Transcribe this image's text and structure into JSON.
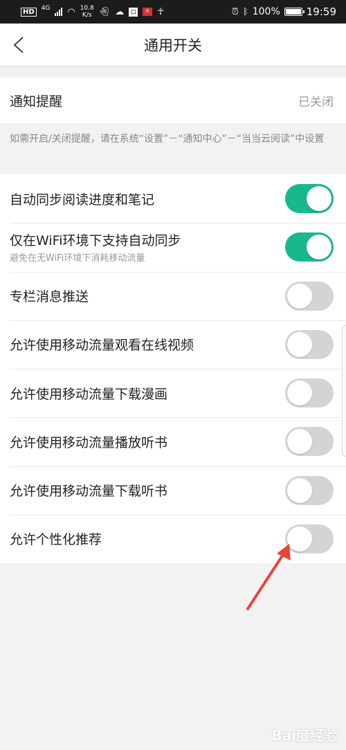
{
  "status_bar": {
    "hd": "HD",
    "network": "4G",
    "speed_top": "10.8",
    "speed_bottom": "K/s",
    "battery": "100%",
    "time": "19:59"
  },
  "header": {
    "title": "通用开关",
    "back_icon": "back-arrow-icon"
  },
  "notification": {
    "label": "通知提醒",
    "status": "已关闭",
    "hint": "如需开启/关闭提醒，请在系统“设置”－“通知中心”－“当当云阅读”中设置"
  },
  "settings": [
    {
      "label": "自动同步阅读进度和笔记",
      "sub": "",
      "on": true
    },
    {
      "label": "仅在WiFi环境下支持自动同步",
      "sub": "避免在无WiFi环境下消耗移动流量",
      "on": true
    },
    {
      "label": "专栏消息推送",
      "sub": "",
      "on": false
    },
    {
      "label": "允许使用移动流量观看在线视频",
      "sub": "",
      "on": false
    },
    {
      "label": "允许使用移动流量下载漫画",
      "sub": "",
      "on": false
    },
    {
      "label": "允许使用移动流量播放听书",
      "sub": "",
      "on": false
    },
    {
      "label": "允许使用移动流量下载听书",
      "sub": "",
      "on": false
    },
    {
      "label": "允许个性化推荐",
      "sub": "",
      "on": false
    }
  ],
  "colors": {
    "toggle_on": "#17b88c",
    "toggle_off": "#d4d4d4",
    "arrow": "#e8443a"
  },
  "watermark": "Bai度经验"
}
